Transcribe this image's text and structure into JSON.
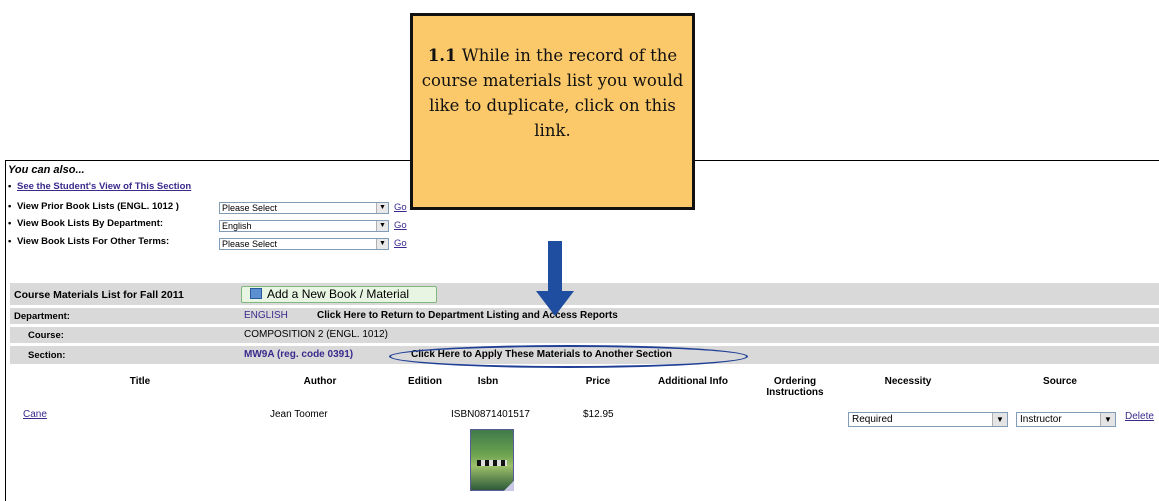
{
  "callout": {
    "bold": "1.1",
    "text": " While in the record of the course materials list you would like to duplicate, click on this link."
  },
  "also": {
    "title": "You can also...",
    "student_view": "See the Student's View of This Section",
    "prior_label": "View Prior Book Lists (ENGL. 1012 )",
    "prior_value": "Please Select",
    "dept_label": "View Book Lists By Department:",
    "dept_value": "English",
    "terms_label": "View Book Lists For Other Terms:",
    "terms_value": "Please Select",
    "go": "Go"
  },
  "materials": {
    "list_title": "Course Materials List for Fall 2011",
    "add_button": "Add a New Book / Material",
    "department_label": "Department:",
    "department_value": "ENGLISH",
    "department_link": "Click Here to Return to Department Listing and Access Reports",
    "course_label": "Course:",
    "course_value": "COMPOSITION 2 (ENGL. 1012)",
    "section_label": "Section:",
    "section_value": "MW9A (reg. code 0391)",
    "apply_link": "Click Here to Apply These Materials to Another Section"
  },
  "table": {
    "headers": {
      "title": "Title",
      "author": "Author",
      "edition": "Edition",
      "isbn": "Isbn",
      "price": "Price",
      "additional": "Additional Info",
      "ordering": "Ordering Instructions",
      "necessity": "Necessity",
      "source": "Source"
    },
    "row": {
      "title": "Cane",
      "author": "Jean Toomer",
      "edition": "",
      "isbn": "ISBN0871401517",
      "price": "$12.95",
      "necessity": "Required",
      "source": "Instructor",
      "delete": "Delete"
    }
  },
  "colors": {
    "callout_bg": "#fcc96a",
    "annotation_blue": "#1f4ea0",
    "bar_gray": "#d9d9d9",
    "link_purple": "#3a2a8c"
  }
}
